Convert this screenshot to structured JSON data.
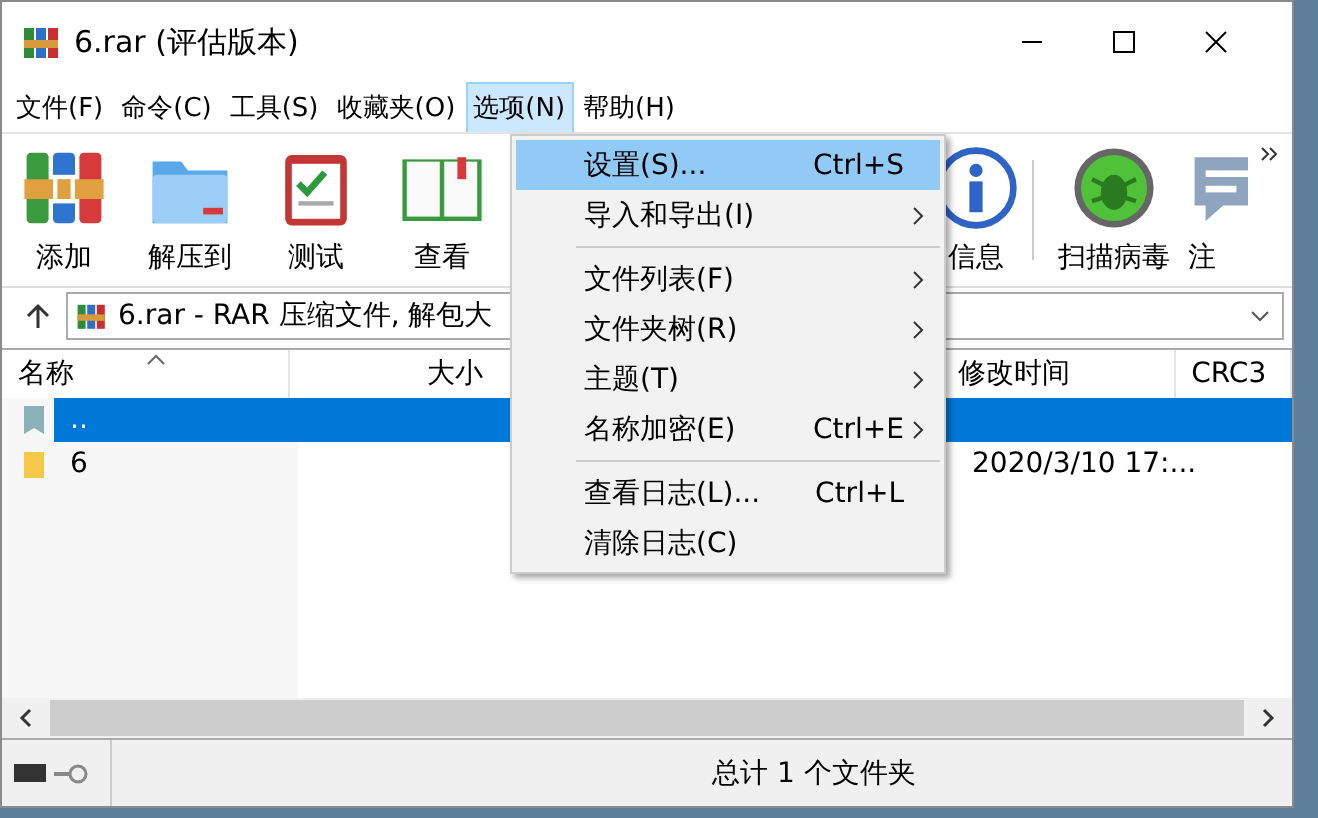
{
  "window": {
    "title": "6.rar (评估版本)"
  },
  "menu": [
    {
      "label": "文件(F)",
      "selected": false
    },
    {
      "label": "命令(C)",
      "selected": false
    },
    {
      "label": "工具(S)",
      "selected": false
    },
    {
      "label": "收藏夹(O)",
      "selected": false
    },
    {
      "label": "选项(N)",
      "selected": true
    },
    {
      "label": "帮助(H)",
      "selected": false
    }
  ],
  "options_menu": [
    {
      "label": "设置(S)...",
      "shortcut": "Ctrl+S",
      "submenu": false,
      "selected": true,
      "separator_after": false
    },
    {
      "label": "导入和导出(I)",
      "submenu": true,
      "selected": false,
      "separator_after": true
    },
    {
      "label": "文件列表(F)",
      "submenu": true,
      "selected": false,
      "separator_after": false
    },
    {
      "label": "文件夹树(R)",
      "submenu": true,
      "selected": false,
      "separator_after": false
    },
    {
      "label": "主题(T)",
      "submenu": true,
      "selected": false,
      "separator_after": false
    },
    {
      "label": "名称加密(E)",
      "shortcut": "Ctrl+E",
      "submenu": true,
      "selected": false,
      "separator_after": true
    },
    {
      "label": "查看日志(L)...",
      "shortcut": "Ctrl+L",
      "submenu": false,
      "selected": false,
      "separator_after": false
    },
    {
      "label": "清除日志(C)",
      "submenu": false,
      "selected": false,
      "separator_after": false
    }
  ],
  "toolbar": [
    {
      "label": "添加",
      "kind": "add"
    },
    {
      "label": "解压到",
      "kind": "extract"
    },
    {
      "label": "测试",
      "kind": "test"
    },
    {
      "label": "查看",
      "kind": "view"
    },
    {
      "label": "信息",
      "kind": "info"
    },
    {
      "label": "扫描病毒",
      "kind": "scan"
    },
    {
      "label": "注",
      "kind": "comment"
    }
  ],
  "address": {
    "text": "6.rar - RAR 压缩文件, 解包大"
  },
  "columns": [
    {
      "label": "名称",
      "sorted": true
    },
    {
      "label": "大小",
      "sorted": false
    },
    {
      "label": "修改时间",
      "sorted": false
    },
    {
      "label": "CRC3",
      "sorted": false
    }
  ],
  "rows": [
    {
      "name": "..",
      "kind": "parent",
      "modified": "",
      "selected": true
    },
    {
      "name": "6",
      "kind": "folder",
      "modified": "2020/3/10 17:...",
      "selected": false
    }
  ],
  "status_bar": {
    "text": "总计 1 个文件夹"
  }
}
